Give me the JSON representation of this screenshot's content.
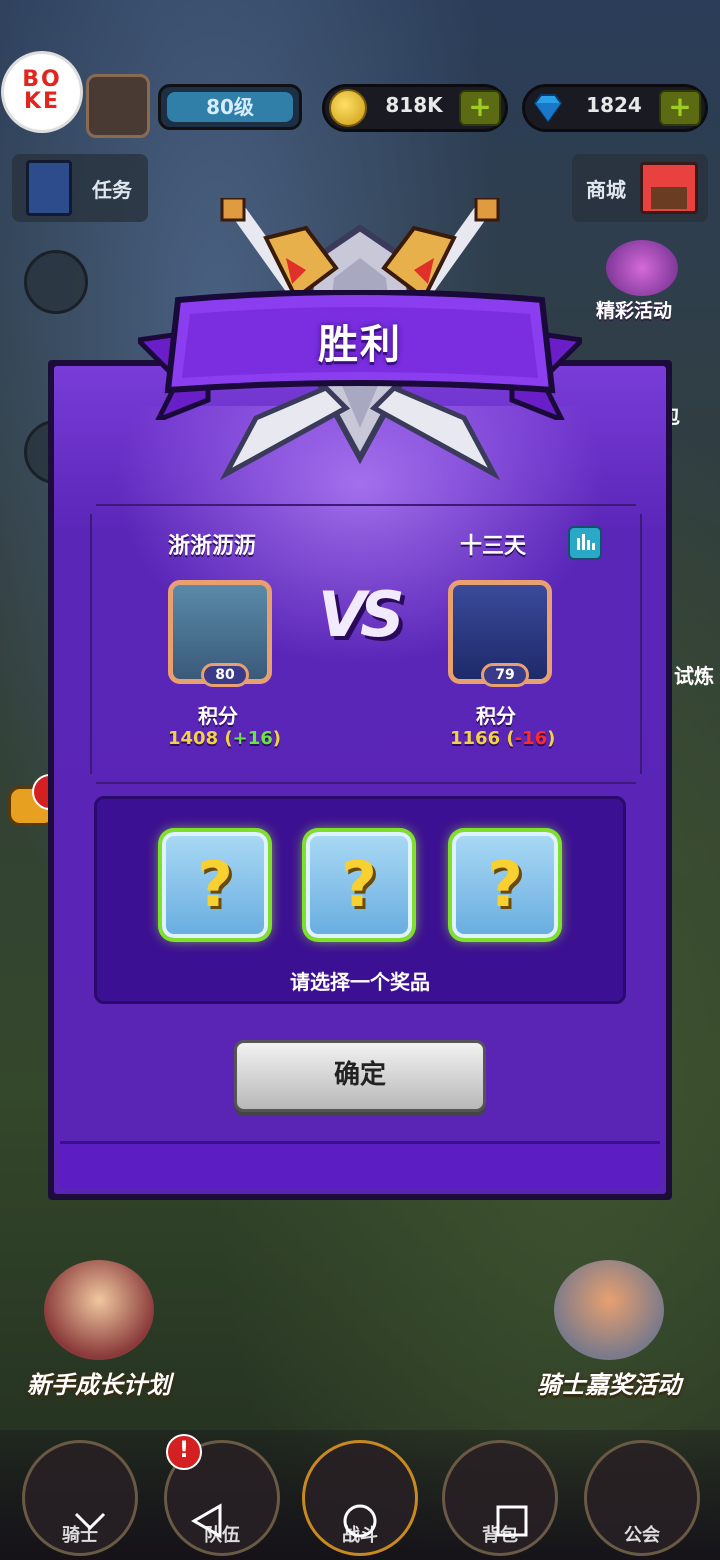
{
  "hud": {
    "logo_text": "BO\nKE",
    "level": "80级",
    "coins": "818K",
    "gems": "1824",
    "add_symbol": "+"
  },
  "side": {
    "quest": "任务",
    "shop": "商城",
    "featured_event": "精彩活动",
    "trial_partial": "试炼",
    "gift_partial": "包"
  },
  "dialog": {
    "title": "胜利",
    "left_player": {
      "name": "浙浙沥沥",
      "level": "80",
      "score_label": "积分",
      "score": "1408",
      "delta_open": "(",
      "delta": "+16",
      "delta_close": ")"
    },
    "right_player": {
      "name": "十三天",
      "level": "79",
      "score_label": "积分",
      "score": "1166",
      "delta_open": "(",
      "delta": "-16",
      "delta_close": ")"
    },
    "vs": "VS",
    "reward_hint": "请选择一个奖品",
    "card_symbol": "?",
    "confirm": "确定"
  },
  "promos": {
    "left": "新手成长计划",
    "right": "骑士嘉奖活动"
  },
  "nav": [
    "骑士",
    "队伍",
    "战斗",
    "背包",
    "公会"
  ],
  "colors": {
    "panel_purple": "#5a26b8",
    "positive": "#6ee04a",
    "negative": "#ff2a2a",
    "gold": "#f4d04a"
  }
}
